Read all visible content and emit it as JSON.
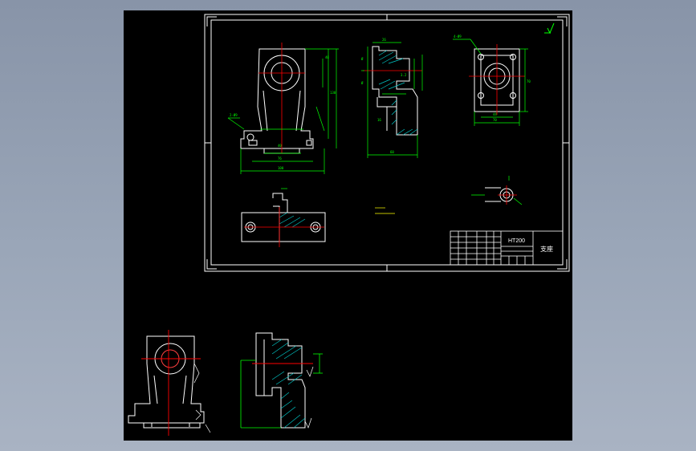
{
  "title_block": {
    "material": "HT200",
    "part_name": "支座"
  },
  "colors": {
    "background": "#000000",
    "outline": "#ffffff",
    "dimension": "#00ff00",
    "centerline": "#ff0000",
    "hatch": "#00c8c8",
    "note": "#ffff00"
  }
}
